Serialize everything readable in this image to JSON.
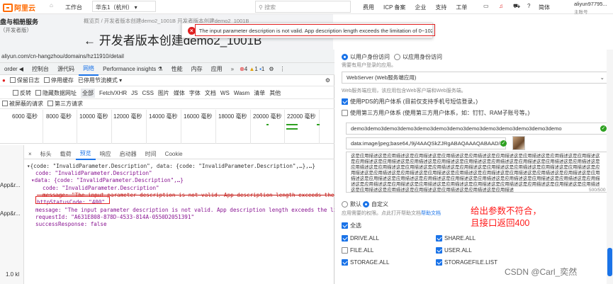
{
  "topnav": {
    "logo": "阿里云",
    "workbench": "工作台",
    "region": "华东1（杭州）",
    "search_placeholder": "搜索",
    "links": [
      "费用",
      "ICP 备案",
      "企业",
      "支持",
      "工单"
    ],
    "lang": "简体",
    "user": "aliyun97795...",
    "user_sub": "主账号"
  },
  "bg_page": {
    "sidebar_title": "盘与相册服务",
    "sidebar_sub": "（开发者版）",
    "breadcrumb": "概览页 / 开发者版本创建demo2_1001B 开发者版本创建demo2_1001B",
    "title": "← 开发者版本创建demo2_1001B"
  },
  "toast": {
    "message": "The input parameter description is not valid. App description length exceeds the limitation of 0~1024."
  },
  "devtools": {
    "url": "aliyun.com/cn-hangzhou/domains/hz11910/detail",
    "tabs": [
      "order ◀",
      "控制台",
      "源代码",
      "网络",
      "Performance insights ⚗",
      "性能",
      "内存",
      "应用"
    ],
    "active_tab": "网络",
    "badges": {
      "errors": "4",
      "warnings": "1",
      "info": "1"
    },
    "toolbar1": [
      "保留日志",
      "停用缓存",
      "已停用节流模式"
    ],
    "toolbar2": [
      "反转",
      "隐藏数据网址",
      "全部",
      "Fetch/XHR",
      "JS",
      "CSS",
      "图片",
      "媒体",
      "字体",
      "文档",
      "WS",
      "Wasm",
      "清单",
      "其他"
    ],
    "toolbar3": [
      "被屏蔽的请求",
      "第三方请求"
    ],
    "timeline_ticks": [
      "6000 毫秒",
      "8000 毫秒",
      "10000 毫秒",
      "12000 毫秒",
      "14000 毫秒",
      "16000 毫秒",
      "18000 毫秒",
      "20000 毫秒",
      "22000 毫秒"
    ],
    "left_items": [
      "App&r...",
      "App&r..."
    ],
    "left_status": "1.0 kl",
    "resp_tabs": [
      "标头",
      "载荷",
      "预览",
      "响应",
      "启动器",
      "时间",
      "Cookie"
    ],
    "resp_active": "预览",
    "json_lines": [
      "▾{code: \"InvalidParameter.Description\", data: {code: \"InvalidParameter.Description\",…},…}",
      "code: \"InvalidParameter.Description\"",
      "▾data: {code: \"InvalidParameter.Description\",…}",
      "code: \"InvalidParameter.Description\"",
      "message: \"The input parameter description is not valid. App description length exceeds the limitati",
      "httpStatusCode: \"400\"",
      "message: \"The input parameter description is not valid. App description length exceeds the limitati",
      "requestId: \"A631E808-878D-4533-814A-0550D2051391\"",
      "successResponse: false"
    ]
  },
  "right": {
    "radio1": "以用户身份访问",
    "radio2": "以应用身份访问",
    "radio_hint": "需要有用户登录的应用。",
    "app_type": "WebServer (Web服务端应用)",
    "app_type_hint": "Web服务端应用，该应用包含Web客户端和Web服务端。",
    "check_pds": "使用PDS的用户体系 (目前仅支持手机号短信登录。)",
    "check_third": "使用第三方用户体系 (使用第三方用户体系，如：钉钉、RAM子账号等。)",
    "name_value": "demo3demo3demo3demo3demo3demo3demo3demo3demo3demo3demo3demo3demo",
    "logo_value": "data:image/jpeg;base64,/9j/4AAQSkZJRgABAQAAAQABAAD/2wB",
    "desc_text": "这是应用描述这是应用描述这是应用描述这是应用描述这是应用描述这是应用描述这是应用描述这是应用描述这是应用描述这是应用描述这是应用描述这是应用描述这是应用描述这是应用描述这是应用描述这是应用描述这是应用描述这是应用描述这是应用描述这是应用描述这是应用描述这是应用描述这是应用描述这是应用描述这是应用描述这是应用描述这是应用描述这是应用描述这是应用描述这是应用描述这是应用描述这是应用描述这是应用描述这是应用描述这是应用描述这是应用描述这是应用描述这是应用描述这是应用描述这是应用描述这是应用描述这是应用描述这是应用描述这是应用描述这是应用描述这是应用描述这是应用描述这是应用描述这是应用描述这是应用描述这是应用描述这是应用描述这是应用描述这是应用描述这是应用描述这是应用描述这是应用描述这是应用描述这是应用描述这是应用描述这是应用描述",
    "desc_count": "500/500",
    "scope_default": "默认",
    "scope_custom": "自定义",
    "scope_hint": "应用需要的权限。点此打开帮助文档",
    "scope_help": "帮助文档",
    "select_all": "全选",
    "perms": [
      {
        "name": "DRIVE.ALL",
        "on": true
      },
      {
        "name": "SHARE.ALL",
        "on": true
      },
      {
        "name": "FILE.ALL",
        "on": false
      },
      {
        "name": "USER.ALL",
        "on": true
      },
      {
        "name": "STORAGE.ALL",
        "on": true
      },
      {
        "name": "STORAGEFILE.LIST",
        "on": true
      }
    ]
  },
  "annotation": {
    "line1": "给出参数不符合，",
    "line2": "且接口返回400"
  },
  "watermark": "CSDN @Carl_奕然",
  "colors": {
    "accent": "#1a73e8",
    "brand": "#ff6a00",
    "error": "#e02020",
    "annotation": "#ff1a1a"
  }
}
